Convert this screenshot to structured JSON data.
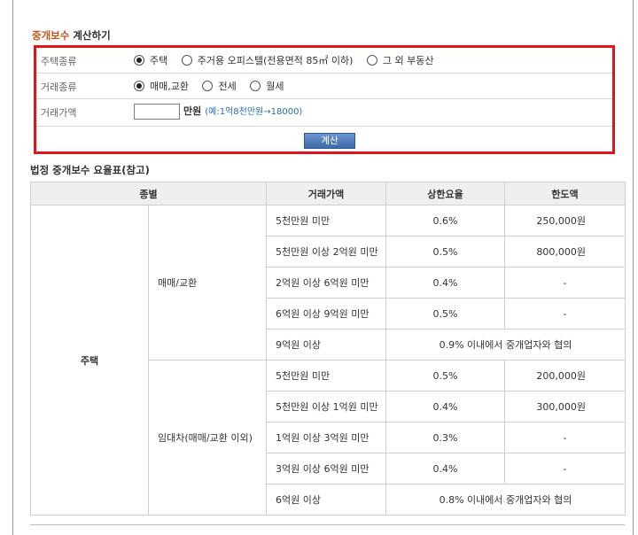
{
  "calculator": {
    "title_accent": "중개보수",
    "title_rest": " 계산하기",
    "row1": {
      "label": "주택종류",
      "options": [
        "주택",
        "주거용 오피스텔(전용면적 85㎡ 이하)",
        "그 외 부동산"
      ],
      "selected": "주택"
    },
    "row2": {
      "label": "거래종류",
      "options": [
        "매매,교환",
        "전세",
        "월세"
      ],
      "selected": "매매,교환"
    },
    "row3": {
      "label": "거래가액",
      "input_value": "",
      "unit": "만원",
      "hint": "(예:1억8천만원→18000)"
    },
    "button": "계산"
  },
  "fee_table": {
    "title": "법정 중개보수 요율표(참고)",
    "headers": [
      "종별",
      "거래가액",
      "상한요율",
      "한도액"
    ],
    "category": "주택",
    "groups": [
      {
        "name": "매매/교환",
        "rows": [
          {
            "price": "5천만원 미만",
            "rate": "0.6%",
            "limit": "250,000원"
          },
          {
            "price": "5천만원 이상 2억원 미만",
            "rate": "0.5%",
            "limit": "800,000원"
          },
          {
            "price": "2억원 이상 6억원 미만",
            "rate": "0.4%",
            "limit": "-"
          },
          {
            "price": "6억원 이상 9억원 미만",
            "rate": "0.5%",
            "limit": "-"
          },
          {
            "price": "9억원 이상",
            "rate_note": "0.9% 이내에서 중개업자와 협의"
          }
        ]
      },
      {
        "name": "임대차(매매/교환 이외)",
        "rows": [
          {
            "price": "5천만원 미만",
            "rate": "0.5%",
            "limit": "200,000원"
          },
          {
            "price": "5천만원 이상 1억원 미만",
            "rate": "0.4%",
            "limit": "300,000원"
          },
          {
            "price": "1억원 이상 3억원 미만",
            "rate": "0.3%",
            "limit": "-"
          },
          {
            "price": "3억원 이상 6억원 미만",
            "rate": "0.4%",
            "limit": "-"
          },
          {
            "price": "6억원 이상",
            "rate_note": "0.8% 이내에서 중개업자와 협의"
          }
        ]
      }
    ]
  }
}
